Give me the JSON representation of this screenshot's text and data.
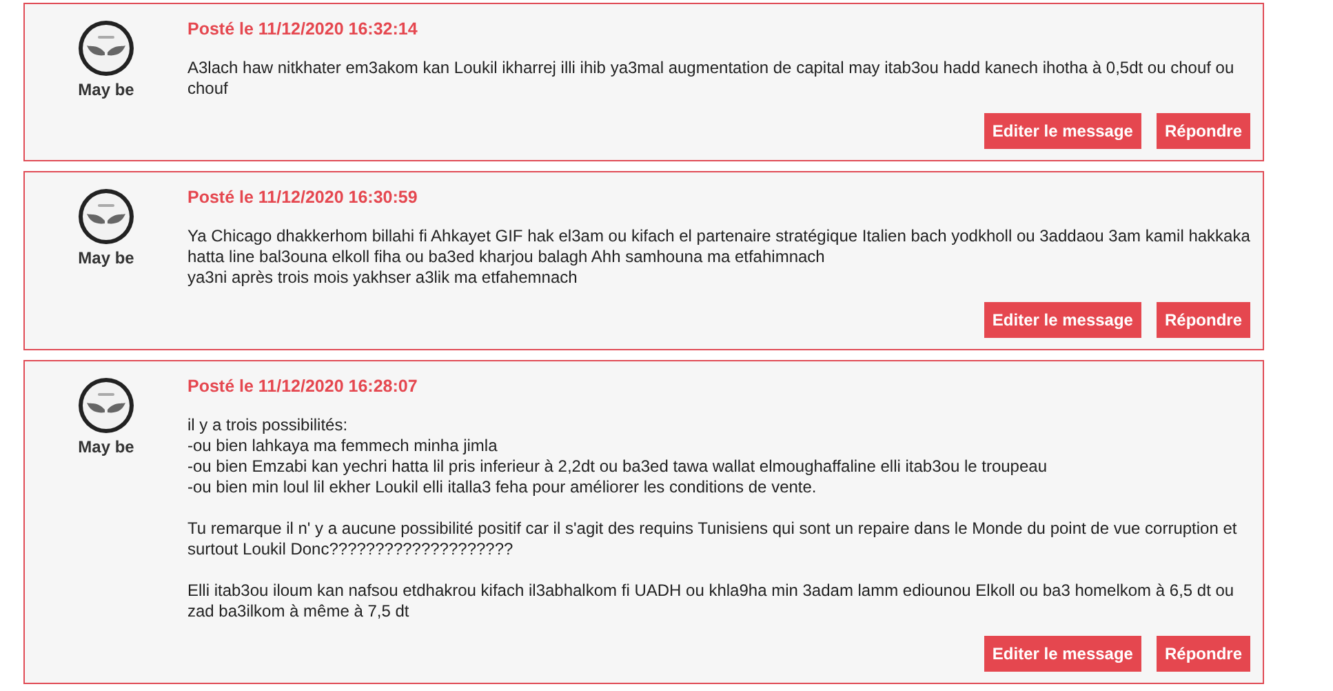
{
  "posts": [
    {
      "author": "May be",
      "date": "Posté le 11/12/2020 16:32:14",
      "paragraphs": [
        [
          "A3lach haw nitkhater em3akom kan Loukil ikharrej illi ihib ya3mal augmentation de capital may itab3ou hadd kanech ihotha à 0,5dt ou chouf ou chouf"
        ]
      ],
      "buttons": [
        "Editer le message",
        "Répondre"
      ]
    },
    {
      "author": "May be",
      "date": "Posté le 11/12/2020 16:30:59",
      "paragraphs": [
        [
          "Ya Chicago dhakkerhom billahi fi Ahkayet GIF hak el3am ou kifach el partenaire stratégique Italien bach yodkholl ou 3addaou 3am kamil hakkaka hatta line bal3ouna elkoll fiha ou ba3ed kharjou balagh Ahh samhouna ma etfahimnach",
          "ya3ni après trois mois yakhser a3lik ma etfahemnach"
        ]
      ],
      "buttons": [
        "Editer le message",
        "Répondre"
      ]
    },
    {
      "author": "May be",
      "date": "Posté le 11/12/2020 16:28:07",
      "paragraphs": [
        [
          "il y a trois possibilités:",
          "-ou bien lahkaya ma femmech minha jimla",
          "-ou bien Emzabi kan yechri hatta lil pris inferieur à 2,2dt ou ba3ed tawa wallat elmoughaffaline elli itab3ou le troupeau",
          "-ou bien min loul lil ekher Loukil elli italla3 feha pour améliorer les conditions de vente."
        ],
        [
          "Tu remarque il n' y a aucune possibilité positif car il s'agit des requins Tunisiens qui sont un repaire dans le Monde du point de vue corruption et surtout Loukil Donc????????????????????"
        ],
        [
          "Elli itab3ou iloum kan nafsou etdhakrou kifach il3abhalkom fi UADH ou khla9ha min 3adam lamm ediounou Elkoll ou ba3 homelkom à 6,5 dt ou zad ba3ilkom à même à 7,5 dt"
        ]
      ],
      "buttons": [
        "Editer le message",
        "Répondre"
      ]
    }
  ]
}
